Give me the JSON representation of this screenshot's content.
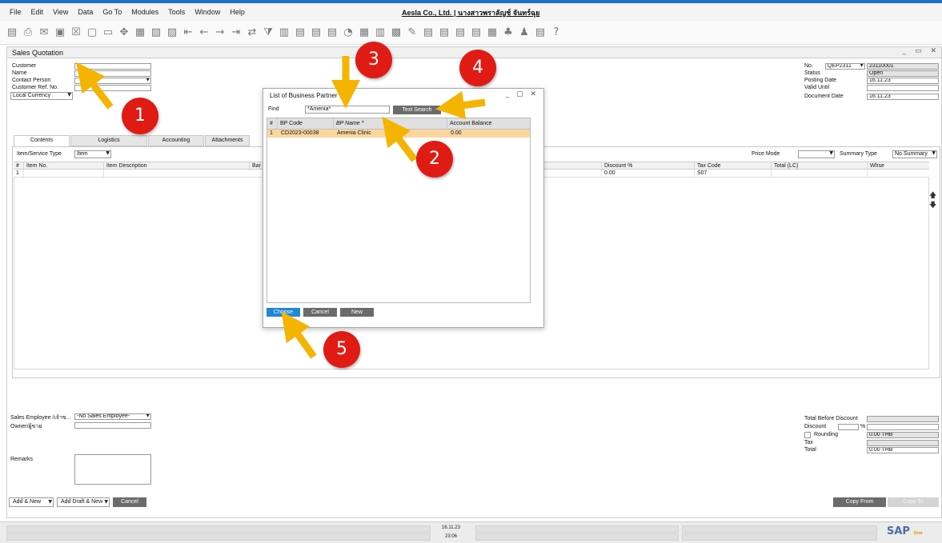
{
  "menu": [
    "File",
    "Edit",
    "View",
    "Data",
    "Go To",
    "Modules",
    "Tools",
    "Window",
    "Help"
  ],
  "company_title": "Aesla Co., Ltd. | นางสาวพราลัญช์ จันทร์ฉุย",
  "window_title": "Sales Quotation",
  "header_left": {
    "customer_label": "Customer",
    "customer_value": "*",
    "name_label": "Name",
    "contact_label": "Contact Person",
    "ref_label": "Customer Ref. No.",
    "currency_value": "Local Currency"
  },
  "header_right": {
    "no_label": "No.",
    "series": "QEP2311",
    "doc_no": "23110001",
    "status_label": "Status",
    "status_value": "Open",
    "posting_label": "Posting Date",
    "posting_value": "16.11.23",
    "valid_label": "Valid Until",
    "docdate_label": "Document Date",
    "docdate_value": "16.11.23"
  },
  "tabs": [
    "Contents",
    "Logistics",
    "Accounting",
    "Attachments"
  ],
  "contents": {
    "type_label": "Item/Service Type",
    "type_value": "Item",
    "price_mode_label": "Price Mode",
    "summary_label": "Summary Type",
    "summary_value": "No Summary",
    "columns": [
      "#",
      "Item No.",
      "Item Description",
      "Bar C",
      "Discount %",
      "Tax Code",
      "Total (LC)",
      "Whse"
    ],
    "row": {
      "num": "1",
      "discount": "0.00",
      "tax": "S07"
    }
  },
  "footer_left": {
    "employee_label": "Sales Employee /เจ้าข...",
    "employee_value": "-No Sales Employee-",
    "owner_label": "Owner/ผู้ขาย",
    "remarks_label": "Remarks"
  },
  "footer_right": {
    "total_before_label": "Total Before Discount",
    "discount_label": "Discount",
    "percent": "%",
    "rounding_label": "Rounding",
    "rounding_value": "0.00 THB",
    "tax_label": "Tax",
    "total_label": "Total",
    "total_value": "0.00 THB"
  },
  "buttons": {
    "add_new": "Add & New",
    "add_draft": "Add Draft & New",
    "cancel": "Cancel",
    "copy_from": "Copy From",
    "copy_to": "Copy To"
  },
  "status": {
    "date": "16.11.23",
    "time": "23:06"
  },
  "sap": {
    "logo": "SAP",
    "business": "Business",
    "one": "One"
  },
  "dialog": {
    "title": "List of Business Partner",
    "find_label": "Find",
    "find_value": "*Amenia*",
    "text_search": "Text Search",
    "columns": [
      "#",
      "BP Code",
      "BP Name ^",
      "Account Balance"
    ],
    "row": {
      "num": "1",
      "code": "CD2023-00038",
      "name": "Amenia Clinic",
      "balance": "0.00"
    },
    "choose": "Choose",
    "cancel": "Cancel",
    "new": "New"
  },
  "annotations": [
    "1",
    "2",
    "3",
    "4",
    "5"
  ],
  "colors": {
    "accent": "#1e88d6",
    "highlight_row": "#fbd7a0",
    "annotation": "#e01b14",
    "arrow": "#f5b400"
  }
}
